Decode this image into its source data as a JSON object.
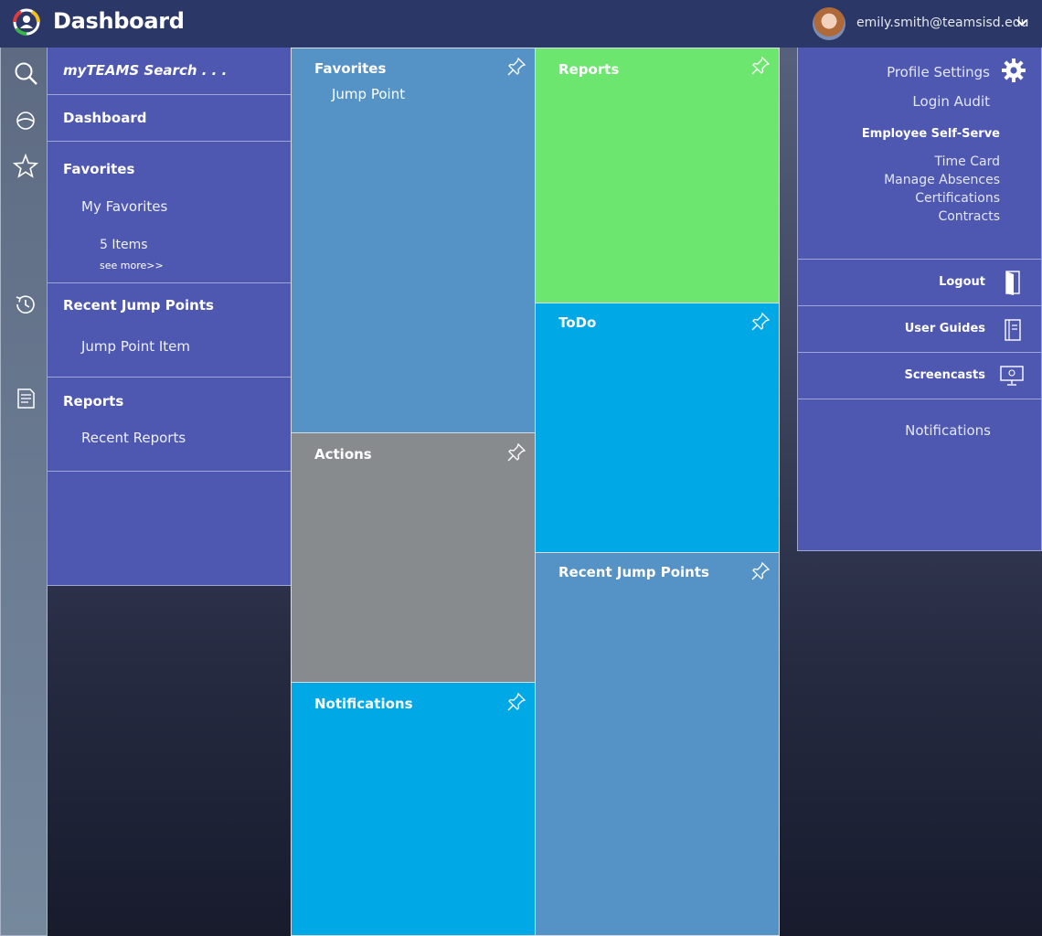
{
  "header": {
    "title": "Dashboard",
    "user_email": "emily.smith@teamsisd.edu"
  },
  "rail": {
    "icons": [
      "search-icon",
      "network-icon",
      "star-icon",
      "history-icon",
      "reports-icon"
    ]
  },
  "nav": {
    "search_label": "myTEAMS Search . . .",
    "dashboard_label": "Dashboard",
    "favorites": {
      "heading": "Favorites",
      "sub_label": "My Favorites",
      "count_label": "5 Items",
      "see_more": "see more>>"
    },
    "recent_jump_points": {
      "heading": "Recent Jump Points",
      "item_label": "Jump Point Item"
    },
    "reports": {
      "heading": "Reports",
      "sub_label": "Recent Reports"
    }
  },
  "tiles": {
    "favorites": {
      "title": "Favorites",
      "item": "Jump Point",
      "color": "#5593c6"
    },
    "actions": {
      "title": "Actions",
      "color": "#878b8e"
    },
    "notifications": {
      "title": "Notifications",
      "color": "#00a8e6"
    },
    "reports": {
      "title": "Reports",
      "color": "#6de670"
    },
    "todo": {
      "title": "ToDo",
      "color": "#00a8e6"
    },
    "recent_jump_points": {
      "title": "Recent Jump Points",
      "color": "#5593c6"
    }
  },
  "menu": {
    "profile_settings": "Profile Settings",
    "login_audit": "Login Audit",
    "ess_heading": "Employee Self-Serve",
    "ess_items": [
      "Time Card",
      "Manage Absences",
      "Certifications",
      "Contracts"
    ],
    "logout": "Logout",
    "user_guides": "User Guides",
    "screencasts": "Screencasts",
    "notifications": "Notifications"
  },
  "colors": {
    "header_bg": "#2b3766",
    "panel_bg": "#4f58b0",
    "accent_green": "#6de670",
    "accent_blue": "#00a8e6",
    "tile_steel": "#5593c6",
    "tile_gray": "#878b8e"
  }
}
